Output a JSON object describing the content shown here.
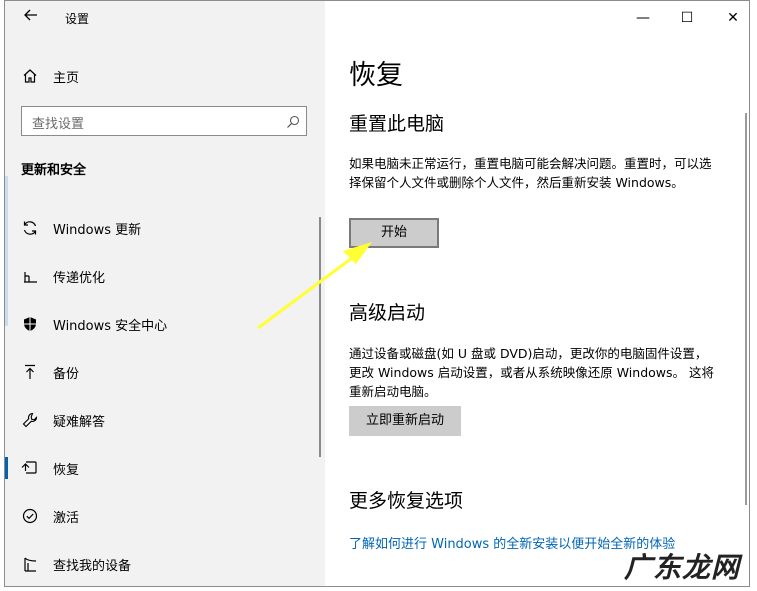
{
  "window": {
    "title": "设置",
    "controls": {
      "minimize": "—",
      "maximize": "☐",
      "close": "✕"
    }
  },
  "sidebar": {
    "home_label": "主页",
    "search_placeholder": "查找设置",
    "section_title": "更新和安全",
    "items": [
      {
        "label": "Windows 更新",
        "icon": "sync-icon",
        "active": false
      },
      {
        "label": "传递优化",
        "icon": "delivery-optimization-icon",
        "active": false
      },
      {
        "label": "Windows 安全中心",
        "icon": "shield-icon",
        "active": false
      },
      {
        "label": "备份",
        "icon": "backup-arrow-icon",
        "active": false
      },
      {
        "label": "疑难解答",
        "icon": "wrench-icon",
        "active": false
      },
      {
        "label": "恢复",
        "icon": "recovery-icon",
        "active": true
      },
      {
        "label": "激活",
        "icon": "activation-check-icon",
        "active": false
      },
      {
        "label": "查找我的设备",
        "icon": "find-device-icon",
        "active": false
      }
    ]
  },
  "main": {
    "page_title": "恢复",
    "reset": {
      "heading": "重置此电脑",
      "description": "如果电脑未正常运行，重置电脑可能会解决问题。重置时，可以选择保留个人文件或删除个人文件，然后重新安装 Windows。",
      "button_label": "开始"
    },
    "advanced": {
      "heading": "高级启动",
      "description": "通过设备或磁盘(如 U 盘或 DVD)启动，更改你的电脑固件设置，更改 Windows 启动设置，或者从系统映像还原 Windows。 这将重新启动电脑。",
      "button_label": "立即重新启动"
    },
    "more": {
      "heading": "更多恢复选项",
      "link": "了解如何进行 Windows 的全新安装以便开始全新的体验"
    }
  },
  "annotation": {
    "arrow_color": "#ffff33"
  },
  "watermark": {
    "text": "广东龙网"
  },
  "colors": {
    "accent": "#0063b1",
    "link": "#0066b4",
    "sidebar_bg": "#f2f2f2",
    "button_bg": "#cccccc"
  }
}
